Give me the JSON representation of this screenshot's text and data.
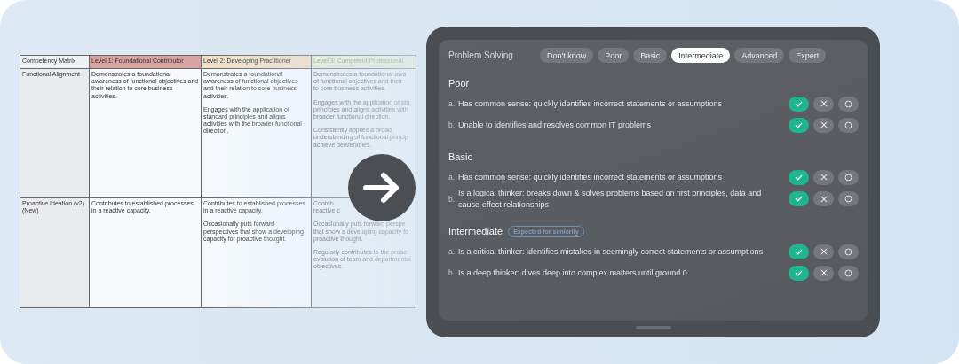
{
  "matrix": {
    "columns": [
      "Competency Matrix",
      "Level 1: Foundational Contributor",
      "Level 2: Developing Practitioner",
      "Level 3: Competent Professional"
    ],
    "rows": [
      {
        "cells": [
          [
            "Functional Alignment"
          ],
          [
            "Demonstrates a foundational awareness of functional objectives and their relation to core business activities."
          ],
          [
            "Demonstrates a foundational awareness of functional objectives and their relation to core business activities.",
            "Engages with the application of standard principles and aligns activities with the broader functional direction."
          ],
          [
            [
              "Demonstrates a foundational awa",
              "of functional objectives and their",
              "to core business activities."
            ],
            [
              "Engages with the application of sta",
              "principles and aligns activities with",
              "broader functional direction."
            ],
            [
              "Consistently applies a broad",
              "understanding of functional princip",
              "achieve deliverables."
            ]
          ]
        ]
      },
      {
        "cells": [
          [
            "Proactive Ideation (v2) (New)"
          ],
          [
            "Contributes to established processes in a reactive capacity."
          ],
          [
            "Contributes to established processes in a reactive capacity.",
            "Occasionally puts forward perspectives that show a developing capacity for proactive thought."
          ],
          [
            [
              "Contrib",
              "reactive c"
            ],
            [
              "Occasionally puts forward perspe",
              "that show a developing capacity fo",
              "proactive thought."
            ],
            [
              "Regularly contributes to the proac",
              "evolution of team and departmental",
              "objectives."
            ]
          ]
        ]
      }
    ]
  },
  "assessment": {
    "title": "Problem Solving",
    "levels": [
      {
        "label": "Don't know",
        "selected": false
      },
      {
        "label": "Poor",
        "selected": false
      },
      {
        "label": "Basic",
        "selected": false
      },
      {
        "label": "Intermediate",
        "selected": true
      },
      {
        "label": "Advanced",
        "selected": false
      },
      {
        "label": "Expert",
        "selected": false
      }
    ],
    "sections": [
      {
        "title": "Poor",
        "items": [
          {
            "marker": "a.",
            "text": "Has common sense: quickly identifies incorrect statements or assumptions",
            "checked": true
          },
          {
            "marker": "b.",
            "text": "Unable to identifies and resolves common IT problems",
            "checked": true
          }
        ]
      },
      {
        "title": "Basic",
        "items": [
          {
            "marker": "a.",
            "text": "Has common sense: quickly identifies incorrect statements or assumptions",
            "checked": true
          },
          {
            "marker": "b.",
            "text": "Is a logical thinker: breaks down & solves problems based on first principles, data and cause-effect relationships",
            "checked": true
          }
        ]
      },
      {
        "title": "Intermediate",
        "badge": "Expected for seniority",
        "items": [
          {
            "marker": "a.",
            "text": "Is a critical thinker: identifies mistakes in seemingly correct statements or assumptions",
            "checked": true
          },
          {
            "marker": "b.",
            "text": "Is a deep thinker: dives deep into complex matters until ground 0",
            "checked": true
          }
        ]
      }
    ]
  }
}
